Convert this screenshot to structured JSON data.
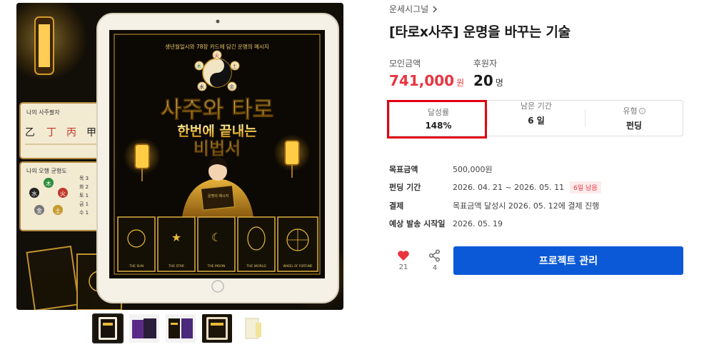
{
  "breadcrumb": {
    "label": "운세시그널"
  },
  "project": {
    "title": "[타로x사주] 운명을 바꾸는 기술"
  },
  "cover": {
    "top_text": "생년월일시와 78장 카드에 담긴 운명의 메시지",
    "title_line1": "사주와 타로",
    "title_line2": "한번에 끝내는",
    "title_line3": "비법서",
    "book_text": "운명의 메시지",
    "elements": [
      "火",
      "土",
      "金",
      "水",
      "木"
    ],
    "cards": [
      "THE SUN",
      "THE STAR",
      "THE MOON",
      "THE WORLD",
      "WHEEL OF FORTUNE"
    ]
  },
  "side_cards": {
    "card1_title": "나의 사주팔자",
    "card1_chars": [
      "乙",
      "丁",
      "丙",
      "甲"
    ],
    "card2_title": "나의 오행 균형도",
    "card2_elements": [
      "木",
      "火",
      "土",
      "金",
      "水"
    ],
    "card2_rows": [
      "목 3",
      "화 2",
      "토 1",
      "금 1",
      "수 1"
    ]
  },
  "funding": {
    "amount_label": "모인금액",
    "amount": "741,000",
    "amount_unit": "원",
    "backers_label": "후원자",
    "backers": "20",
    "backers_unit": "명"
  },
  "stats": {
    "rate_label": "달성률",
    "rate": "148%",
    "remaining_label": "남은 기간",
    "remaining": "6 일",
    "type_label": "유형",
    "type": "펀딩"
  },
  "details": [
    {
      "key": "목표금액",
      "value": "500,000원",
      "badge": ""
    },
    {
      "key": "펀딩 기간",
      "value": "2026. 04. 21 ~ 2026. 05. 11",
      "badge": "6일 남음"
    },
    {
      "key": "결제",
      "value": "목표금액 달성시 2026. 05. 12에 결제 진행",
      "badge": ""
    },
    {
      "key": "예상 발송 시작일",
      "value": "2026. 05. 19",
      "badge": ""
    }
  ],
  "actions": {
    "like_count": "21",
    "share_count": "4",
    "manage_label": "프로젝트 관리"
  },
  "colors": {
    "accent_red": "#e8343f",
    "primary_blue": "#0b59d6",
    "highlight_box": "#e00012",
    "cover_gold": "#e8b93a"
  }
}
